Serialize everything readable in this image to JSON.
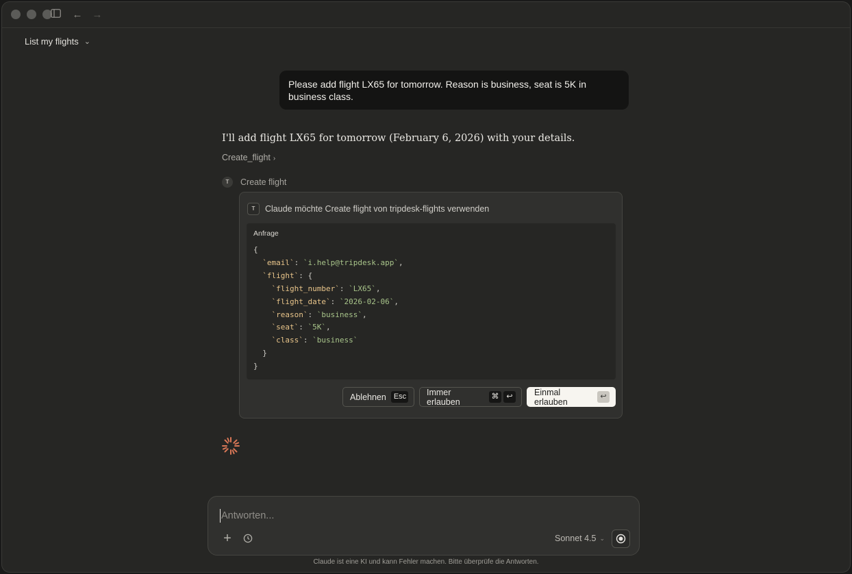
{
  "titlebar": {
    "icons": [
      "close-traffic-light",
      "minimize-traffic-light",
      "maximize-traffic-light",
      "sidebar-toggle-icon",
      "arrow-left-icon",
      "arrow-right-icon"
    ],
    "back_glyph": "←",
    "forward_glyph": "→"
  },
  "chat": {
    "title": "List my flights",
    "title_chevron": "⌄"
  },
  "user_message": {
    "text": "Please add flight LX65 for tomorrow. Reason is business, seat is 5K in business class."
  },
  "assistant": {
    "text": "I'll add flight LX65 for tomorrow (February 6, 2026) with your details.",
    "tool_link": "Create_flight",
    "tool_link_chevron": "›",
    "tool_row_badge": "T",
    "tool_row_label": "Create flight"
  },
  "permission": {
    "badge": "T",
    "header": "Claude möchte Create flight von tripdesk-flights verwenden",
    "request_label": "Anfrage",
    "code": {
      "open": "{",
      "email_key": "`email`",
      "email_value": "`i.help@tripdesk.app`",
      "flight_key": "`flight`",
      "flight_number_key": "`flight_number`",
      "flight_number_value": "`LX65`",
      "flight_date_key": "`flight_date`",
      "flight_date_value": "`2026-02-06`",
      "reason_key": "`reason`",
      "reason_value": "`business`",
      "seat_key": "`seat`",
      "seat_value": "`5K`",
      "class_key": "`class`",
      "class_value": "`business`",
      "inner_close": "}",
      "close": "}"
    },
    "buttons": {
      "deny_label": "Ablehnen",
      "deny_key": "Esc",
      "always_label": "Immer erlauben",
      "always_key1": "⌘",
      "always_key2": "↩",
      "once_label": "Einmal erlauben",
      "once_key": "↩"
    }
  },
  "composer": {
    "placeholder": "Antworten...",
    "plus_glyph": "+",
    "model": "Sonnet 4.5",
    "model_chevron": "⌄"
  },
  "footer": {
    "disclaimer": "Claude ist eine KI und kann Fehler machen. Bitte überprüfe die Antworten."
  },
  "colors": {
    "background": "#262624",
    "accent_spinner": "#d97757",
    "primary_button": "#f7f5f0"
  }
}
